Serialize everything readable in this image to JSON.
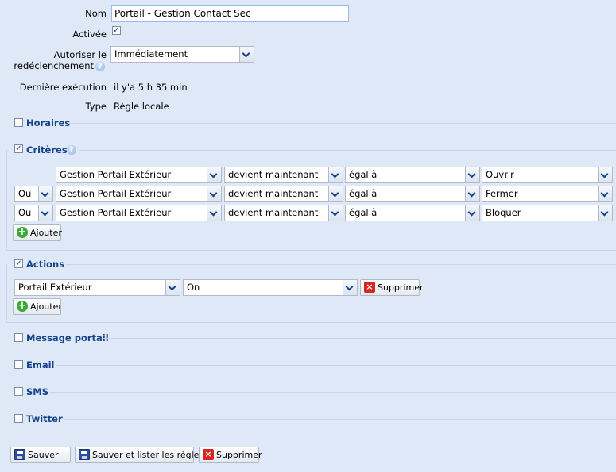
{
  "form": {
    "name_label": "Nom",
    "name_value": "Portail - Gestion Contact Sec",
    "enabled_label": "Activée",
    "retrigger_label_line1": "Autoriser le",
    "retrigger_label_line2": "redéclenchement",
    "retrigger_value": "Immédiatement",
    "last_run_label": "Dernière exécution",
    "last_run_value": "il y'a 5 h 35 min",
    "type_label": "Type",
    "type_value": "Règle locale",
    "help_glyph": "?"
  },
  "sections": {
    "horaires": {
      "title": "Horaires",
      "checked": false
    },
    "criteres": {
      "title": "Critères",
      "checked": true
    },
    "actions": {
      "title": "Actions",
      "checked": true
    },
    "message": {
      "title": "Message portail",
      "checked": false
    },
    "email": {
      "title": "Email",
      "checked": false
    },
    "sms": {
      "title": "SMS",
      "checked": false
    },
    "twitter": {
      "title": "Twitter",
      "checked": false
    }
  },
  "criteria": [
    {
      "logic": "",
      "device": "Gestion Portail Extérieur",
      "condition": "devient maintenant",
      "operator": "égal à",
      "value": "Ouvrir"
    },
    {
      "logic": "Ou",
      "device": "Gestion Portail Extérieur",
      "condition": "devient maintenant",
      "operator": "égal à",
      "value": "Fermer"
    },
    {
      "logic": "Ou",
      "device": "Gestion Portail Extérieur",
      "condition": "devient maintenant",
      "operator": "égal à",
      "value": "Bloquer"
    }
  ],
  "criteria_add_label": "Ajouter",
  "action": {
    "device": "Portail Extérieur",
    "value": "On",
    "delete_label": "Supprimer"
  },
  "actions_add_label": "Ajouter",
  "footer": {
    "save_label": "Sauver",
    "save_list_label": "Sauver et lister les règles",
    "delete_label": "Supprimer"
  },
  "checkmark_glyph": "✓",
  "colors": {
    "background": "#dfe8f6",
    "section_title": "#15428b",
    "border": "#99bbe8"
  }
}
